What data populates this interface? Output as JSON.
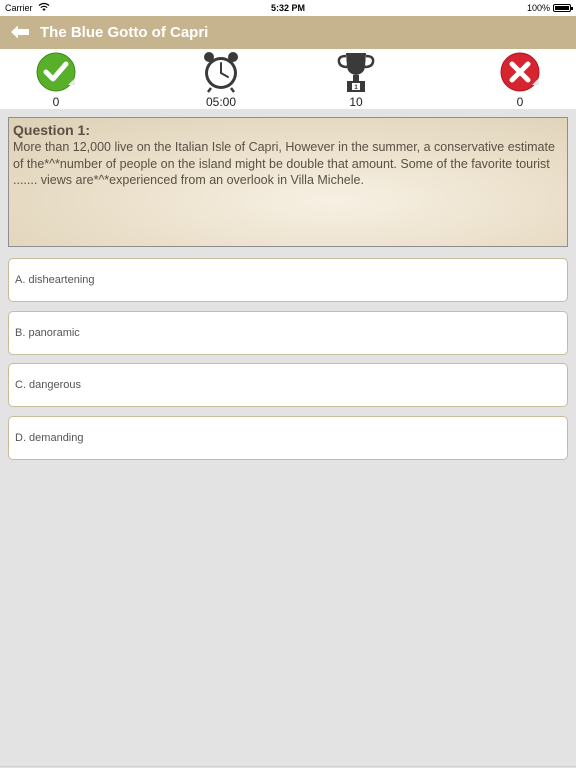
{
  "status_bar": {
    "carrier": "Carrier",
    "time": "5:32 PM",
    "battery": "100%"
  },
  "nav": {
    "title": "The Blue Gotto of Capri",
    "back_icon": "left-arrow-icon"
  },
  "stats": {
    "correct": "0",
    "timer": "05:00",
    "score": "10",
    "wrong": "0"
  },
  "question": {
    "title": "Question 1:",
    "text": "More than 12,000 live on the Italian Isle of Capri, However in the summer, a conservative estimate of the*^*number of people on the island might be double that amount. Some of the favorite tourist ....... views are*^*experienced from an overlook in Villa Michele."
  },
  "options": [
    {
      "label": "A. disheartening"
    },
    {
      "label": "B. panoramic"
    },
    {
      "label": "C. dangerous"
    },
    {
      "label": "D. demanding"
    }
  ],
  "colors": {
    "nav": "#c6b48f",
    "correct": "#58b02a",
    "wrong": "#d62430",
    "icon_dark": "#3a3a3a"
  }
}
